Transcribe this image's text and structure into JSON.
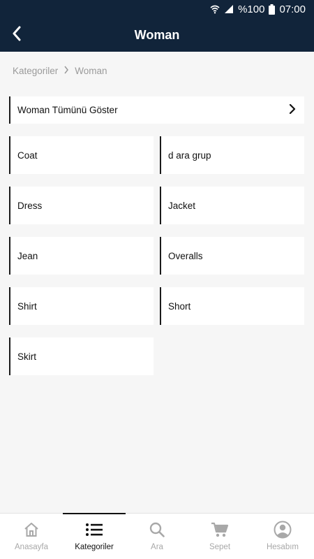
{
  "status_bar": {
    "battery_text": "%100",
    "time": "07:00",
    "icons": [
      "wifi-icon",
      "signal-icon",
      "battery-icon"
    ]
  },
  "header": {
    "title": "Woman",
    "back_icon": "chevron-left-icon"
  },
  "breadcrumb": {
    "items": [
      "Kategoriler",
      "Woman"
    ]
  },
  "all_row": {
    "label": "Woman Tümünü Göster",
    "icon": "chevron-right-icon"
  },
  "categories": [
    "Coat",
    "d ara grup",
    "Dress",
    "Jacket",
    "Jean",
    "Overalls",
    "Shirt",
    "Short",
    "Skirt"
  ],
  "bottom_nav": {
    "active_index": 1,
    "items": [
      {
        "label": "Anasayfa",
        "icon": "home-icon"
      },
      {
        "label": "Kategoriler",
        "icon": "list-icon"
      },
      {
        "label": "Ara",
        "icon": "search-icon"
      },
      {
        "label": "Sepet",
        "icon": "cart-icon"
      },
      {
        "label": "Hesabım",
        "icon": "account-icon"
      }
    ]
  },
  "colors": {
    "header_bg": "#11243a",
    "page_bg": "#f6f6f6",
    "accent": "#111111",
    "inactive": "#a8a8a8"
  }
}
